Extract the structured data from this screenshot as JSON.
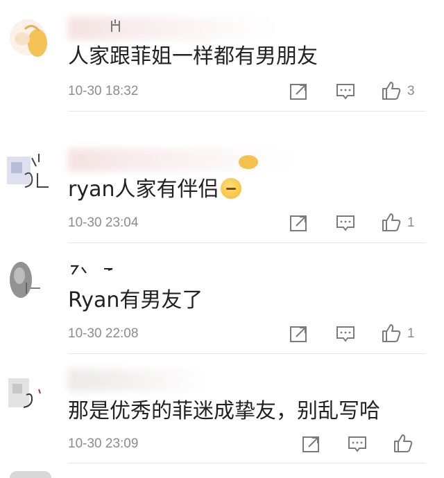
{
  "colors": {
    "text": "#222222",
    "meta": "#8c8c8c",
    "icon": "#7a7a7a",
    "divider": "#e6e6e6"
  },
  "icons": {
    "share": "share-icon",
    "reply": "reply-icon",
    "like": "thumbs-up-icon"
  },
  "comments": [
    {
      "text": "人家跟菲姐一样都有男朋友",
      "time": "10-30 18:32",
      "likes": "3"
    },
    {
      "text": "ryan人家有伴侣",
      "time": "10-30 23:04",
      "likes": "1"
    },
    {
      "text": "Ryan有男友了",
      "time": "10-30 22:08",
      "likes": "1"
    },
    {
      "text": "那是优秀的菲迷成挚友，别乱写哈",
      "time": "10-30 23:09",
      "likes": ""
    }
  ]
}
